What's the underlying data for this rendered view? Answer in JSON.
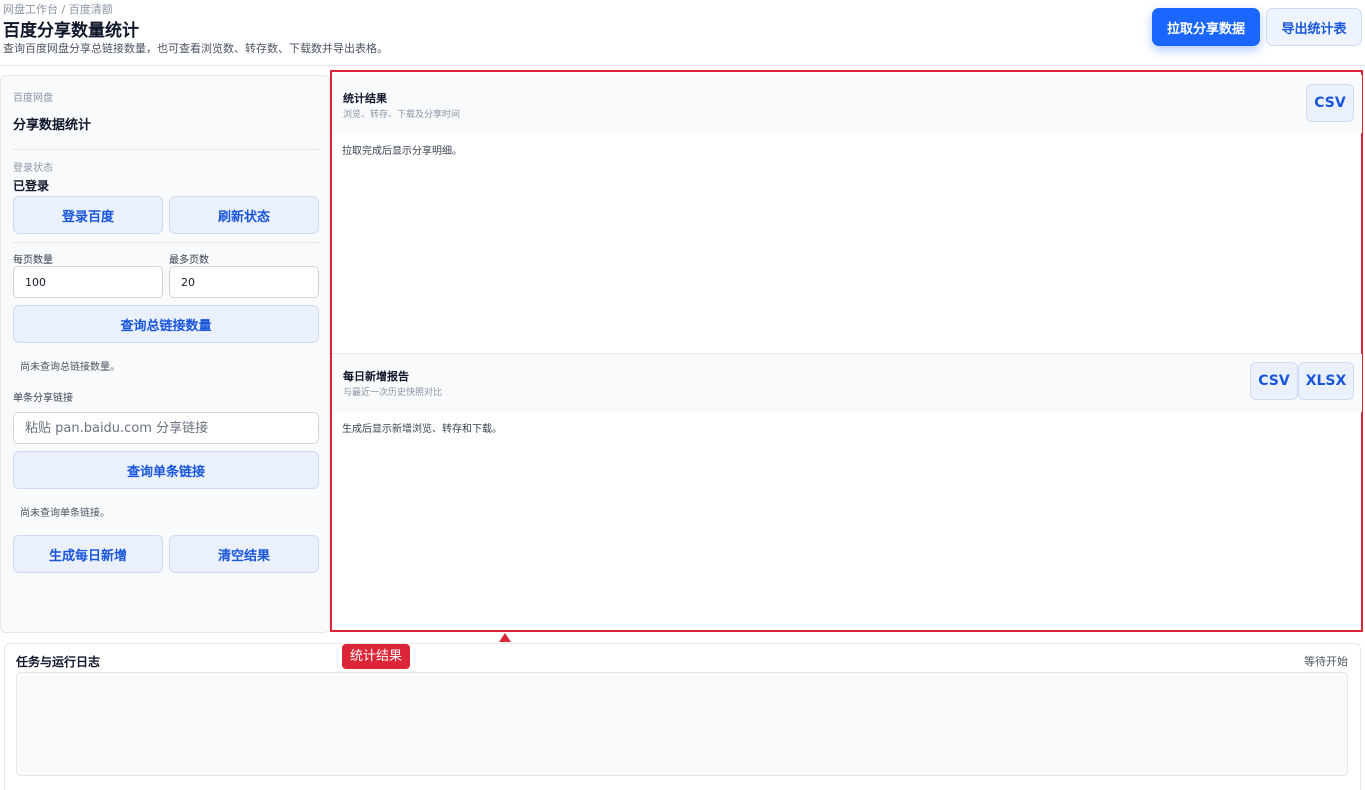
{
  "header": {
    "breadcrumb": "网盘工作台 / 百度清额",
    "title": "百度分享数量统计",
    "subtitle": "查询百度网盘分享总链接数量，也可查看浏览数、转存数、下载数并导出表格。",
    "primary_button": "拉取分享数据",
    "secondary_button": "导出统计表"
  },
  "sidebar": {
    "section_label": "百度网盘",
    "title": "分享数据统计",
    "login_label": "登录状态",
    "login_status": "已登录",
    "login_button": "登录百度",
    "refresh_button": "刷新状态",
    "page_size_label": "每页数量",
    "page_size_value": "100",
    "max_pages_label": "最多页数",
    "max_pages_value": "20",
    "query_total_button": "查询总链接数量",
    "total_note": "尚未查询总链接数量。",
    "single_link_label": "单条分享链接",
    "single_link_placeholder": "粘贴 pan.baidu.com 分享链接",
    "query_single_button": "查询单条链接",
    "single_note": "尚未查询单条链接。",
    "daily_button": "生成每日新增",
    "clear_button": "清空结果"
  },
  "results": {
    "title": "统计结果",
    "subtitle": "浏览、转存、下载及分享时间",
    "csv_label": "CSV",
    "body": "拉取完成后显示分享明细。"
  },
  "daily": {
    "title": "每日新增报告",
    "subtitle": "与最近一次历史快照对比",
    "csv_label": "CSV",
    "xlsx_label": "XLSX",
    "body": "生成后显示新增浏览、转存和下载。"
  },
  "marker": {
    "label": "统计结果"
  },
  "log": {
    "title": "任务与运行日志",
    "status": "等待开始"
  },
  "colors": {
    "primary": "#1a66ff",
    "highlight": "#dc2637",
    "button_bg": "#eaf1fd"
  }
}
